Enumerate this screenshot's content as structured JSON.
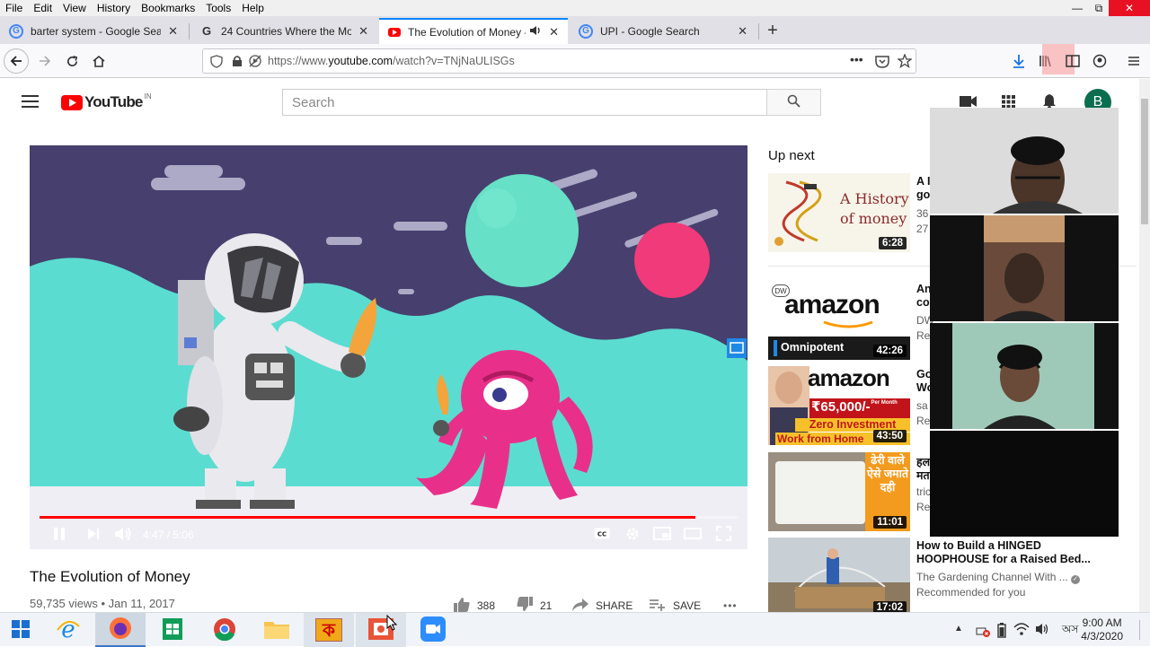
{
  "menu": [
    "File",
    "Edit",
    "View",
    "History",
    "Bookmarks",
    "Tools",
    "Help"
  ],
  "tabs": [
    {
      "label": "barter system - Google Search",
      "favicon": "google-icon"
    },
    {
      "label": "24 Countries Where the Mone",
      "favicon": "g-icon"
    },
    {
      "label": "The Evolution of Money - Y",
      "favicon": "youtube-icon"
    },
    {
      "label": "UPI - Google Search",
      "favicon": "google-icon"
    }
  ],
  "new_tab": "+",
  "url": {
    "prefix": "https://www.",
    "domain": "youtube.com",
    "path": "/watch?v=TNjNaULISGs"
  },
  "youtube": {
    "logo_text": "YouTube",
    "region": "IN",
    "search_placeholder": "Search",
    "avatar_letter": "B"
  },
  "player": {
    "time": "4:47 / 5:06",
    "progress": 0.94
  },
  "video": {
    "title": "The Evolution of Money",
    "meta": "59,735 views • Jan 11, 2017",
    "likes": "388",
    "dislikes": "21",
    "share": "SHARE",
    "save": "SAVE",
    "more": "•••"
  },
  "upnext": {
    "title": "Up next",
    "items": [
      {
        "duration": "6:28",
        "thumb_text": "A History of money",
        "title1": "A I",
        "title2": "go",
        "sub1": "36",
        "sub2": "27"
      },
      {
        "duration": "42:26",
        "thumb_text": "amazon",
        "thumb_sub": "Omnipotent",
        "badge": "DW",
        "title1": "An",
        "title2": "co",
        "sub1": "DW",
        "sub2": "Re"
      },
      {
        "duration": "43:50",
        "thumb_text": "amazon",
        "thumb_price": "₹65,000/-",
        "thumb_permonth": "Per Month",
        "thumb_line1": "Zero Investment",
        "thumb_line2": "Work from Home",
        "title1": "Go",
        "title2": "Wo",
        "sub1": "sa",
        "sub2": "Re"
      },
      {
        "duration": "11:01",
        "thumb_text": "ढेरी वाले ऐसे जमाते दही",
        "title1": "हल",
        "title2": "मत",
        "sub1": "tric",
        "sub2": "Re"
      },
      {
        "duration": "17:02",
        "title1": "How to Build a HINGED",
        "title2": "HOOPHOUSE for a Raised Bed...",
        "sub1": "The Gardening Channel With ...",
        "sub2": "Recommended for you"
      }
    ]
  },
  "taskbar": {
    "time": "9:00 AM",
    "date": "4/3/2020",
    "lang": "অস"
  },
  "colors": {
    "accent": "#0a84ff",
    "youtube_red": "#ff0000",
    "avatar": "#0b6e4f"
  }
}
